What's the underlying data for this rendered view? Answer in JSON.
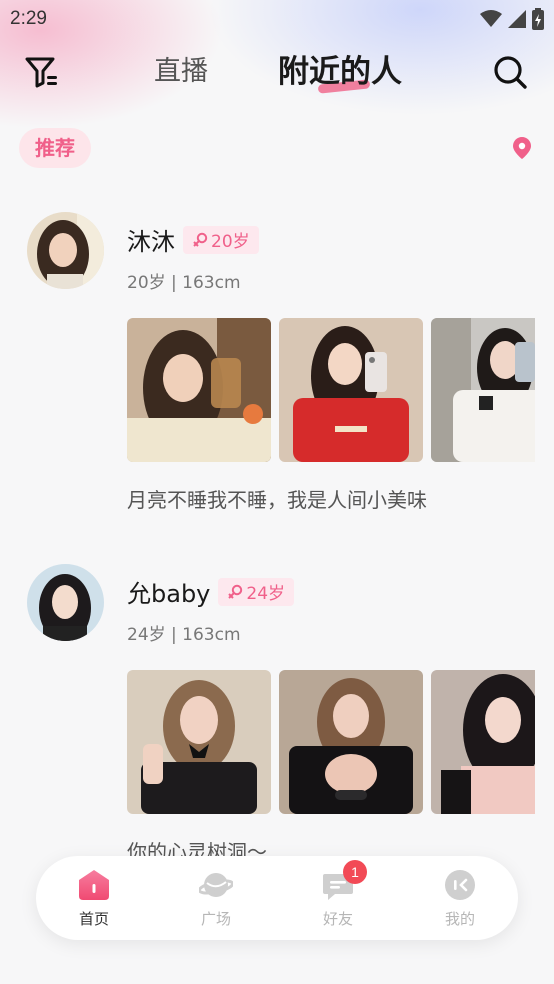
{
  "status": {
    "time": "2:29"
  },
  "header": {
    "tabs": [
      {
        "label": "直播"
      },
      {
        "label": "附近的人"
      }
    ]
  },
  "subbar": {
    "chip": "推荐"
  },
  "profiles": [
    {
      "name": "沐沐",
      "age_badge": "20岁",
      "meta": "20岁 | 163cm",
      "bio": "月亮不睡我不睡，我是人间小美味"
    },
    {
      "name": "允baby",
      "age_badge": "24岁",
      "meta": "24岁 | 163cm",
      "bio": "你的心灵树洞～"
    }
  ],
  "nav": {
    "items": [
      {
        "label": "首页",
        "icon": "home-icon"
      },
      {
        "label": "广场",
        "icon": "planet-icon"
      },
      {
        "label": "好友",
        "icon": "chat-icon",
        "badge": "1"
      },
      {
        "label": "我的",
        "icon": "profile-icon"
      }
    ]
  },
  "colors": {
    "accent": "#f0608a",
    "badge": "#f24a56",
    "background": "#f7f7f8"
  }
}
